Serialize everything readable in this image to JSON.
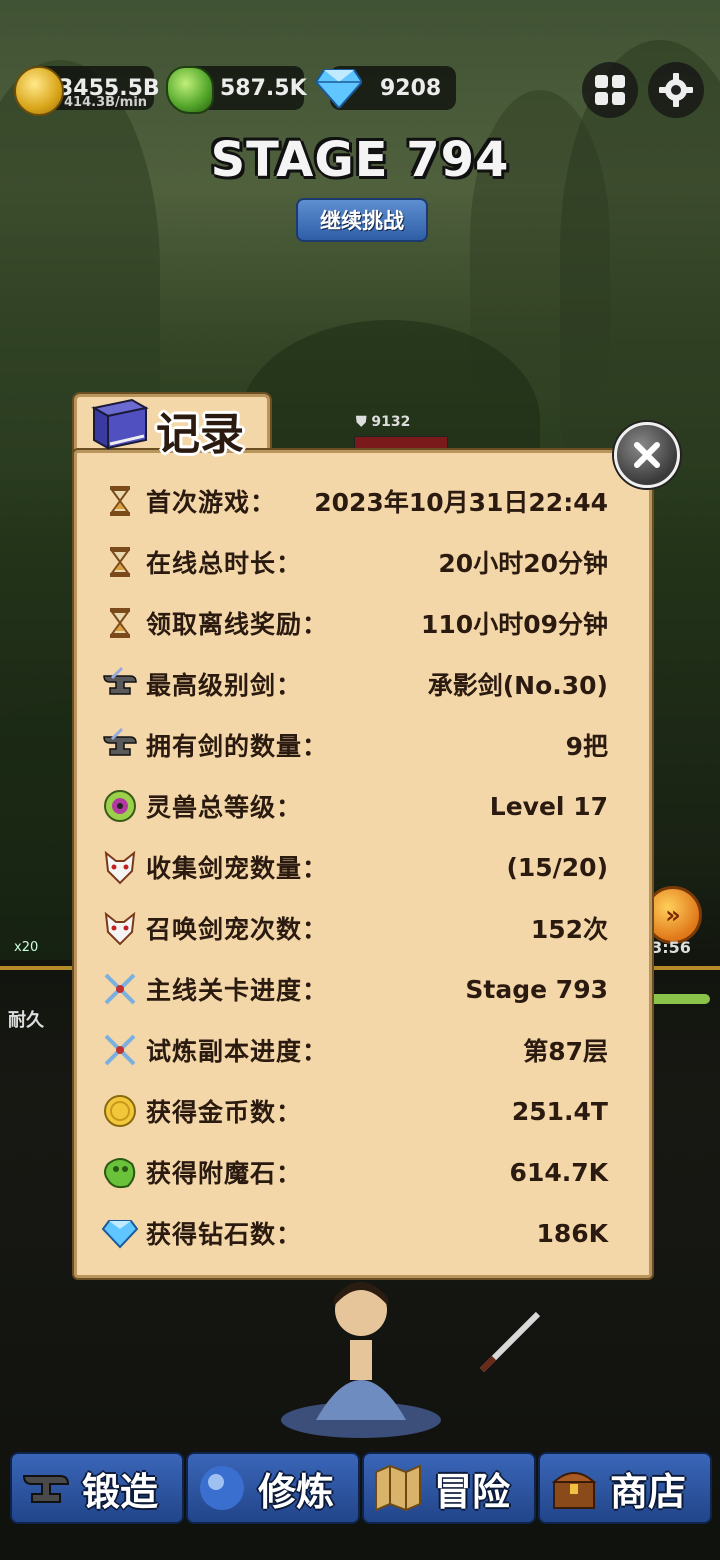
{
  "topbar": {
    "gold": "3455.5B",
    "gold_rate": "414.3B/min",
    "enchant_stone": "587.5K",
    "diamonds": "9208"
  },
  "stage": {
    "title": "STAGE 794",
    "continue_label": "继续挑战"
  },
  "background": {
    "enemy_hp": "9132",
    "gem_count": "x20",
    "durability_label": "耐久",
    "timer": "03:56"
  },
  "records": {
    "title": "记录",
    "rows": [
      {
        "icon": "hourglass-icon",
        "label": "首次游戏：",
        "value": "2023年10月31日22:44"
      },
      {
        "icon": "hourglass-icon",
        "label": "在线总时长：",
        "value": "20小时20分钟"
      },
      {
        "icon": "hourglass-icon",
        "label": "领取离线奖励：",
        "value": "110小时09分钟"
      },
      {
        "icon": "anvil-icon",
        "label": "最高级别剑：",
        "value": "承影剑(No.30)"
      },
      {
        "icon": "anvil-icon",
        "label": "拥有剑的数量：",
        "value": "9把"
      },
      {
        "icon": "spirit-orb-icon",
        "label": "灵兽总等级：",
        "value": "Level 17"
      },
      {
        "icon": "fox-mask-icon",
        "label": "收集剑宠数量：",
        "value": "(15/20)"
      },
      {
        "icon": "fox-mask-icon",
        "label": "召唤剑宠次数：",
        "value": "152次"
      },
      {
        "icon": "crossed-swords-icon",
        "label": "主线关卡进度：",
        "value": "Stage 793"
      },
      {
        "icon": "crossed-swords-icon",
        "label": "试炼副本进度：",
        "value": "第87层"
      },
      {
        "icon": "gold-coin-icon",
        "label": "获得金币数：",
        "value": "251.4T"
      },
      {
        "icon": "enchant-stone-icon",
        "label": "获得附魔石：",
        "value": "614.7K"
      },
      {
        "icon": "diamond-icon",
        "label": "获得钻石数：",
        "value": "186K"
      }
    ]
  },
  "nav": [
    {
      "icon": "anvil-icon",
      "label": "锻造"
    },
    {
      "icon": "orb-icon",
      "label": "修炼"
    },
    {
      "icon": "map-icon",
      "label": "冒险"
    },
    {
      "icon": "chest-icon",
      "label": "商店"
    }
  ],
  "colors": {
    "panel_bg": "#f4d7a8",
    "panel_border": "#b8955c",
    "nav_blue": "#2f5ea8",
    "text_dark": "#2a1a10"
  }
}
